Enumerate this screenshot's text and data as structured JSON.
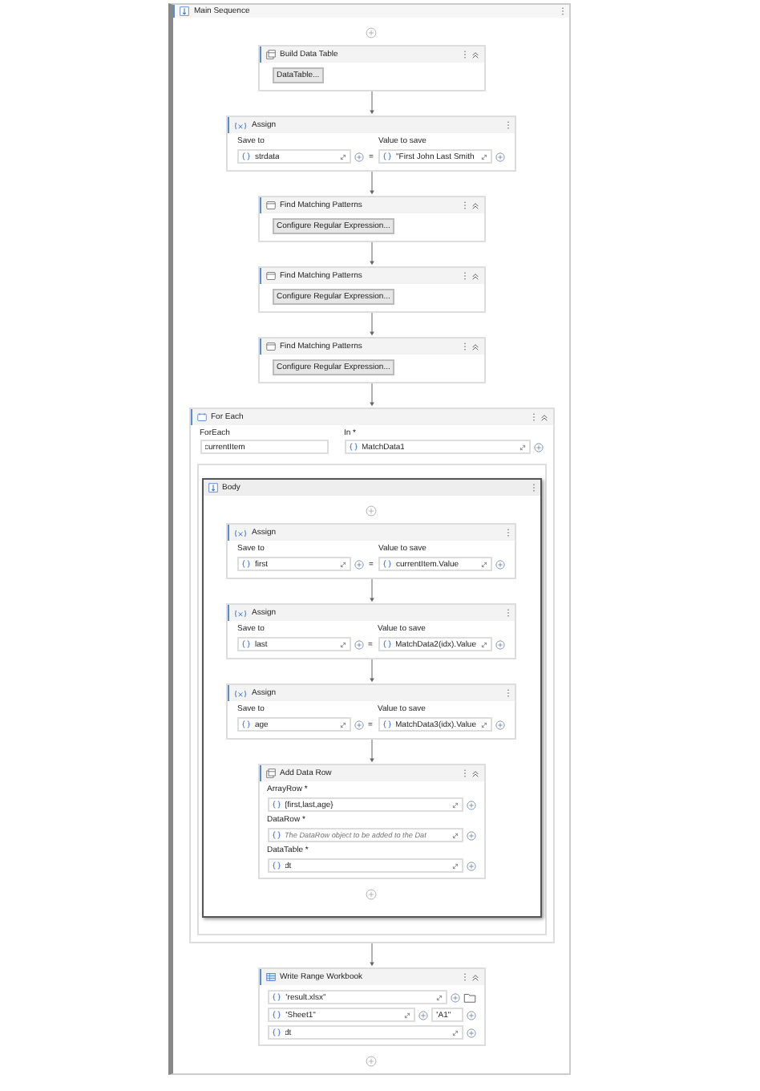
{
  "main": {
    "title": "Main Sequence",
    "activities": [
      {
        "kind": "build_table",
        "title": "Build Data Table",
        "button": "DataTable..."
      },
      {
        "kind": "assign",
        "title": "Assign",
        "save_label": "Save to",
        "value_label": "Value to save",
        "save_to": "strdata",
        "operator": "=",
        "value": "\"First John Last Smith"
      },
      {
        "kind": "find_patterns",
        "title": "Find Matching Patterns",
        "button": "Configure Regular Expression..."
      },
      {
        "kind": "find_patterns",
        "title": "Find Matching Patterns",
        "button": "Configure Regular Expression..."
      },
      {
        "kind": "find_patterns",
        "title": "Find Matching Patterns",
        "button": "Configure Regular Expression..."
      },
      {
        "kind": "for_each",
        "title": "For Each",
        "item_label": "ForEach",
        "item": "currentItem",
        "in_label": "In *",
        "in": "MatchData1",
        "body": {
          "title": "Body",
          "activities": [
            {
              "kind": "assign",
              "title": "Assign",
              "save_label": "Save to",
              "value_label": "Value to save",
              "save_to": "first",
              "operator": "=",
              "value": "currentItem.Value"
            },
            {
              "kind": "assign",
              "title": "Assign",
              "save_label": "Save to",
              "value_label": "Value to save",
              "save_to": "last",
              "operator": "=",
              "value": "MatchData2(idx).Value"
            },
            {
              "kind": "assign",
              "title": "Assign",
              "save_label": "Save to",
              "value_label": "Value to save",
              "save_to": "age",
              "operator": "=",
              "value": "MatchData3(idx).Value"
            },
            {
              "kind": "add_data_row",
              "title": "Add Data Row",
              "fields": [
                {
                  "label": "ArrayRow *",
                  "value": "{first,last,age}"
                },
                {
                  "label": "DataRow *",
                  "placeholder": "The DataRow object to be added to the Dat"
                },
                {
                  "label": "DataTable *",
                  "value": "dt"
                }
              ]
            }
          ]
        }
      },
      {
        "kind": "write_range",
        "title": "Write Range Workbook",
        "path": "\"result.xlsx\"",
        "sheet": "\"Sheet1\"",
        "range": "\"A1\"",
        "table": "dt"
      }
    ]
  }
}
